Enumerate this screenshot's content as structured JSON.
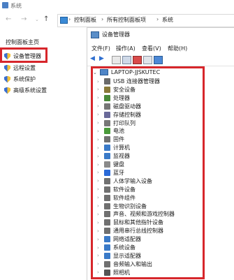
{
  "window": {
    "title": "系统"
  },
  "address": {
    "segments": [
      "控制面板",
      "所有控制面板项",
      "系统"
    ]
  },
  "left_panel": {
    "title": "控制面板主页",
    "items": [
      {
        "label": "设备管理器"
      },
      {
        "label": "远程设置"
      },
      {
        "label": "系统保护"
      },
      {
        "label": "高级系统设置"
      }
    ]
  },
  "device_manager": {
    "title": "设备管理器",
    "menu": [
      "文件(F)",
      "操作(A)",
      "查看(V)",
      "帮助(H)"
    ],
    "root": "LAPTOP-JJSKUTEC",
    "nodes": [
      {
        "label": "USB 连接器管理器",
        "icon": "usb-icon",
        "color": "#6b6b6b"
      },
      {
        "label": "安全设备",
        "icon": "security-icon",
        "color": "#8a7a3a"
      },
      {
        "label": "处理器",
        "icon": "cpu-icon",
        "color": "#4a8a3a"
      },
      {
        "label": "磁盘驱动器",
        "icon": "disk-icon",
        "color": "#777777"
      },
      {
        "label": "存储控制器",
        "icon": "storage-icon",
        "color": "#6a6a9a"
      },
      {
        "label": "打印队列",
        "icon": "printer-icon",
        "color": "#777777"
      },
      {
        "label": "电池",
        "icon": "battery-icon",
        "color": "#4a9a3a"
      },
      {
        "label": "固件",
        "icon": "firmware-icon",
        "color": "#707070"
      },
      {
        "label": "计算机",
        "icon": "computer-icon",
        "color": "#3a7ac8"
      },
      {
        "label": "监视器",
        "icon": "monitor-icon",
        "color": "#3a7ac8"
      },
      {
        "label": "键盘",
        "icon": "keyboard-icon",
        "color": "#8a8a8a"
      },
      {
        "label": "蓝牙",
        "icon": "bluetooth-icon",
        "color": "#2a6ad8"
      },
      {
        "label": "人体学输入设备",
        "icon": "hid-icon",
        "color": "#707070"
      },
      {
        "label": "软件设备",
        "icon": "software-device-icon",
        "color": "#707070"
      },
      {
        "label": "软件组件",
        "icon": "software-component-icon",
        "color": "#707070"
      },
      {
        "label": "生物识别设备",
        "icon": "biometric-icon",
        "color": "#707070"
      },
      {
        "label": "声音、视频和游戏控制器",
        "icon": "sound-icon",
        "color": "#707070"
      },
      {
        "label": "鼠标和其他指针设备",
        "icon": "mouse-icon",
        "color": "#707070"
      },
      {
        "label": "通用串行总线控制器",
        "icon": "usb-controller-icon",
        "color": "#707070"
      },
      {
        "label": "网络适配器",
        "icon": "network-icon",
        "color": "#3a7ac8"
      },
      {
        "label": "系统设备",
        "icon": "system-device-icon",
        "color": "#3a7ac8"
      },
      {
        "label": "显示适配器",
        "icon": "display-adapter-icon",
        "color": "#3a7ac8"
      },
      {
        "label": "音频输入和输出",
        "icon": "audio-icon",
        "color": "#707070"
      },
      {
        "label": "照相机",
        "icon": "camera-icon",
        "color": "#555555"
      }
    ]
  },
  "highlight_color": "#d7262b"
}
